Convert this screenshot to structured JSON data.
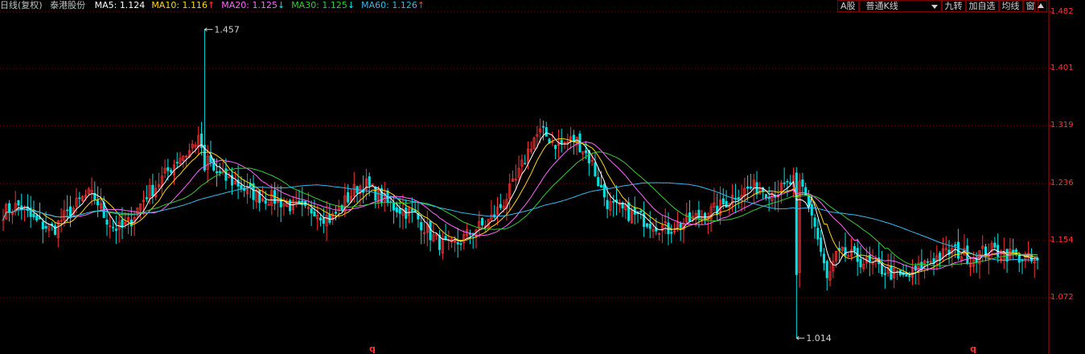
{
  "header": {
    "title": "日线(复权)",
    "stock_name": "泰港股份"
  },
  "ma_legend": [
    {
      "label": "MA5:",
      "value": "1.124",
      "arrow": "",
      "color": "#ffffff"
    },
    {
      "label": "MA10:",
      "value": "1.116",
      "arrow": "↑",
      "color": "#ffd700"
    },
    {
      "label": "MA20:",
      "value": "1.125",
      "arrow": "↓",
      "color": "#ff66ff"
    },
    {
      "label": "MA30:",
      "value": "1.125",
      "arrow": "↓",
      "color": "#33cc33"
    },
    {
      "label": "MA60:",
      "value": "1.126",
      "arrow": "↑",
      "color": "#33bbee"
    }
  ],
  "toolbar": {
    "a_share": "A股",
    "kline_type": "普通K线",
    "jiuzhuan": "九转",
    "add_watch": "加自选",
    "ma_line": "均线",
    "window": "窗"
  },
  "colors": {
    "up": "#ff3232",
    "down": "#00e0e0",
    "grid": "#7a0000",
    "axis": "#c00000"
  },
  "chart_data": {
    "type": "candlestick",
    "ylim": [
      1.0,
      1.482
    ],
    "y_ticks": [
      "1.482",
      "1.401",
      "1.319",
      "1.236",
      "1.154",
      "1.072"
    ],
    "annotations": [
      {
        "text": "1.457",
        "value": 1.457,
        "kind": "high"
      },
      {
        "text": "1.014",
        "value": 1.014,
        "kind": "low"
      }
    ],
    "series_shapes": [
      {
        "name": "MA5",
        "color": "#ffffff"
      },
      {
        "name": "MA10",
        "color": "#ffd700"
      },
      {
        "name": "MA20",
        "color": "#ff66ff"
      },
      {
        "name": "MA30",
        "color": "#33cc33"
      },
      {
        "name": "MA60",
        "color": "#33bbee"
      }
    ],
    "close_path": [
      1.195,
      1.2,
      1.205,
      1.19,
      1.18,
      1.175,
      1.17,
      1.185,
      1.195,
      1.21,
      1.22,
      1.215,
      1.19,
      1.175,
      1.17,
      1.18,
      1.2,
      1.22,
      1.23,
      1.245,
      1.26,
      1.275,
      1.28,
      1.3,
      1.28,
      1.255,
      1.245,
      1.24,
      1.235,
      1.225,
      1.22,
      1.215,
      1.215,
      1.21,
      1.205,
      1.2,
      1.195,
      1.2,
      1.19,
      1.185,
      1.2,
      1.215,
      1.23,
      1.235,
      1.225,
      1.215,
      1.205,
      1.2,
      1.195,
      1.19,
      1.175,
      1.16,
      1.15,
      1.145,
      1.15,
      1.16,
      1.17,
      1.175,
      1.185,
      1.2,
      1.22,
      1.24,
      1.27,
      1.3,
      1.31,
      1.3,
      1.29,
      1.295,
      1.3,
      1.285,
      1.265,
      1.23,
      1.205,
      1.2,
      1.195,
      1.19,
      1.185,
      1.18,
      1.175,
      1.17,
      1.175,
      1.18,
      1.185,
      1.19,
      1.195,
      1.2,
      1.21,
      1.22,
      1.225,
      1.23,
      1.23,
      1.225,
      1.225,
      1.23,
      1.24,
      1.23,
      1.2,
      1.15,
      1.095,
      1.13,
      1.135,
      1.13,
      1.125,
      1.12,
      1.115,
      1.11,
      1.105,
      1.1,
      1.105,
      1.115,
      1.125,
      1.13,
      1.135,
      1.14,
      1.135,
      1.13,
      1.135,
      1.14,
      1.14,
      1.135,
      1.135,
      1.13,
      1.125,
      1.12
    ]
  },
  "markers": [
    {
      "text": "q"
    },
    {
      "text": "q"
    }
  ]
}
